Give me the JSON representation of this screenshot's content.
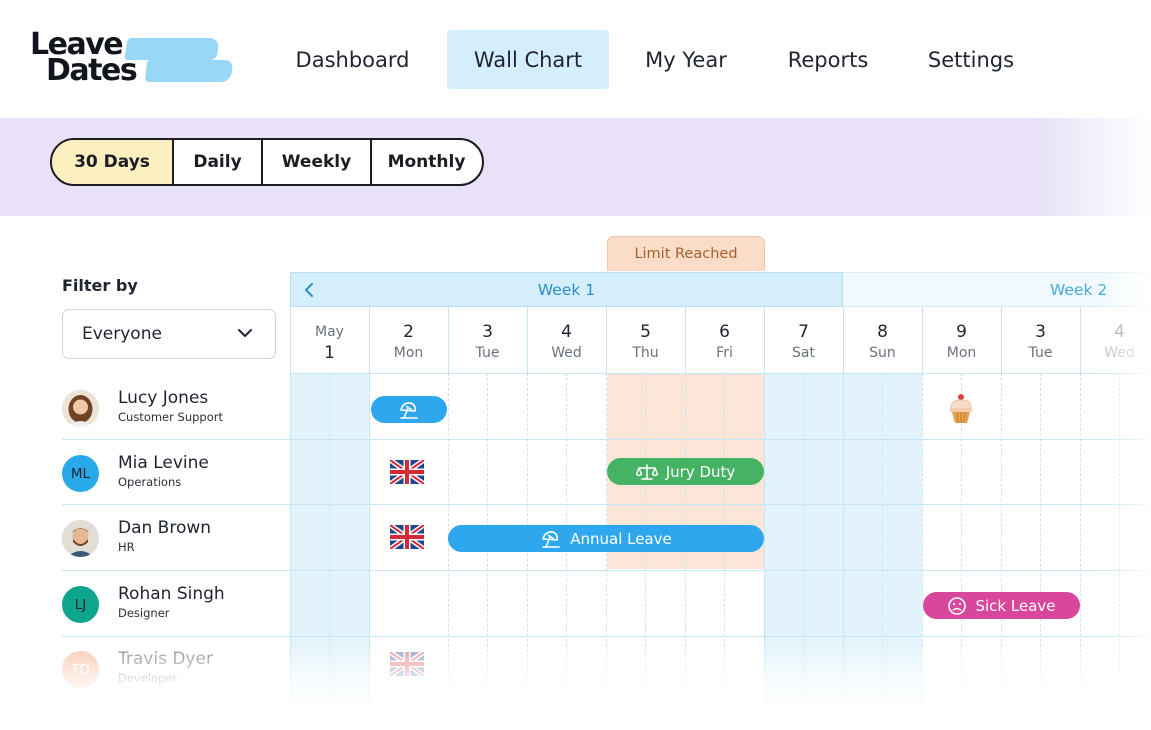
{
  "brand": {
    "line1": "Leave",
    "line2": "Dates"
  },
  "nav": [
    {
      "label": "Dashboard",
      "active": false
    },
    {
      "label": "Wall Chart",
      "active": true
    },
    {
      "label": "My Year",
      "active": false
    },
    {
      "label": "Reports",
      "active": false
    },
    {
      "label": "Settings",
      "active": false
    }
  ],
  "view_options": [
    {
      "label": "30 Days",
      "selected": true
    },
    {
      "label": "Daily",
      "selected": false
    },
    {
      "label": "Weekly",
      "selected": false
    },
    {
      "label": "Monthly",
      "selected": false
    }
  ],
  "filter": {
    "label": "Filter by",
    "value": "Everyone"
  },
  "limit_badge": "Limit Reached",
  "weeks": [
    "Week 1",
    "Week 2"
  ],
  "days": [
    {
      "month": "May",
      "num": "1"
    },
    {
      "num": "2",
      "wd": "Mon"
    },
    {
      "num": "3",
      "wd": "Tue"
    },
    {
      "num": "4",
      "wd": "Wed"
    },
    {
      "num": "5",
      "wd": "Thu"
    },
    {
      "num": "6",
      "wd": "Fri"
    },
    {
      "num": "7",
      "wd": "Sat"
    },
    {
      "num": "8",
      "wd": "Sun"
    },
    {
      "num": "9",
      "wd": "Mon"
    },
    {
      "num": "3",
      "wd": "Tue"
    },
    {
      "num": "4",
      "wd": "Wed"
    }
  ],
  "people": [
    {
      "name": "Lucy Jones",
      "role": "Customer Support",
      "initials": ""
    },
    {
      "name": "Mia Levine",
      "role": "Operations",
      "initials": "ML"
    },
    {
      "name": "Dan Brown",
      "role": "HR",
      "initials": ""
    },
    {
      "name": "Rohan Singh",
      "role": "Designer",
      "initials": "LJ"
    },
    {
      "name": "Travis Dyer",
      "role": "Developer",
      "initials": "TD"
    }
  ],
  "leave_types": {
    "jury": "Jury Duty",
    "annual": "Annual Leave",
    "sick": "Sick Leave"
  },
  "colors": {
    "annual": "#2ea7ef",
    "jury": "#46b364",
    "sick": "#d9479d",
    "nav_active": "#d4effb",
    "selected_view": "#fbefbf",
    "limit": "#fbdcc8"
  },
  "icons": {
    "annual": "beach-umbrella-icon",
    "jury": "scales-icon",
    "sick": "sad-face-icon",
    "birthday": "cupcake-icon",
    "holiday": "uk-flag-icon"
  }
}
